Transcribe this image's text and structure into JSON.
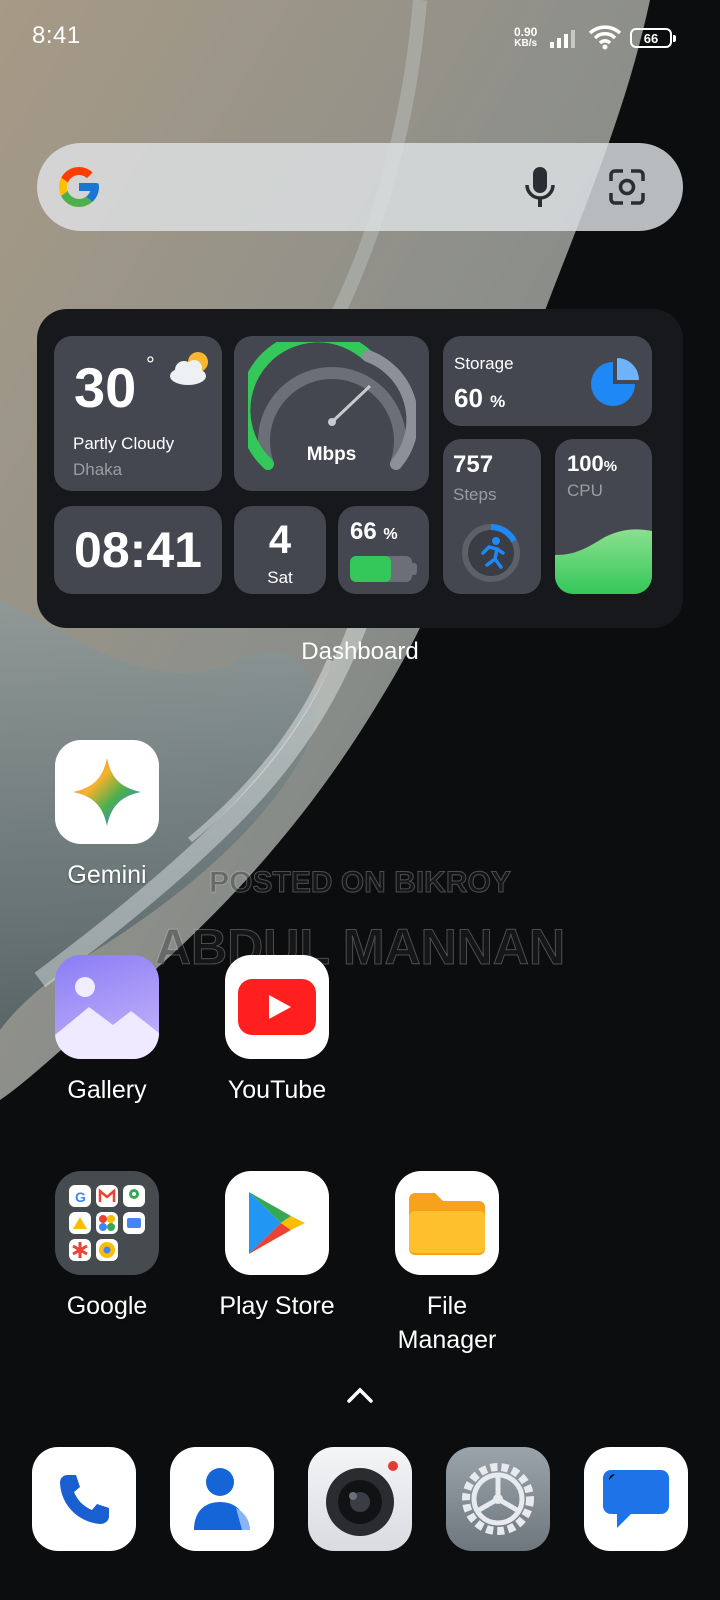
{
  "status_bar": {
    "time": "8:41",
    "net_speed_value": "0.90",
    "net_speed_unit": "KB/s",
    "battery": "66"
  },
  "search": {
    "logo_icon": "google-g-logo",
    "mic_icon": "mic-icon",
    "lens_icon": "camera-lens-icon"
  },
  "widget": {
    "weather": {
      "temp": "30",
      "degree": "°",
      "condition": "Partly Cloudy",
      "city": "Dhaka",
      "icon": "partly-cloudy-icon"
    },
    "speed": {
      "unit": "Mbps"
    },
    "storage": {
      "label": "Storage",
      "value": "60",
      "unit": "%",
      "fill_fraction": 0.6
    },
    "clock": {
      "time": "08:41"
    },
    "date": {
      "day_num": "4",
      "day_name": "Sat"
    },
    "battery": {
      "value": "66",
      "unit": "%",
      "fill_fraction": 0.66
    },
    "steps": {
      "value": "757",
      "label": "Steps",
      "icon": "running-person-icon"
    },
    "cpu": {
      "value": "100",
      "unit": "%",
      "label": "CPU"
    },
    "title": "Dashboard"
  },
  "watermark": {
    "line1": "POSTED ON BIKROY",
    "line2": "ABDUL MANNAN"
  },
  "apps": [
    {
      "label": "Gemini",
      "icon": "gemini-icon"
    },
    {
      "label": "Gallery",
      "icon": "gallery-icon"
    },
    {
      "label": "YouTube",
      "icon": "youtube-icon"
    },
    {
      "label": "Google",
      "icon": "google-folder-icon"
    },
    {
      "label": "Play Store",
      "icon": "play-store-icon"
    },
    {
      "label": "File\nManager",
      "icon": "folder-icon"
    }
  ],
  "app_drawer_icon": "chevron-up-icon",
  "dock": [
    {
      "icon": "phone-icon"
    },
    {
      "icon": "contacts-icon"
    },
    {
      "icon": "camera-icon"
    },
    {
      "icon": "settings-gear-icon"
    },
    {
      "icon": "messages-icon"
    }
  ],
  "colors": {
    "green": "#34c759",
    "blue": "#1e88f5",
    "tile": "#44474f"
  }
}
